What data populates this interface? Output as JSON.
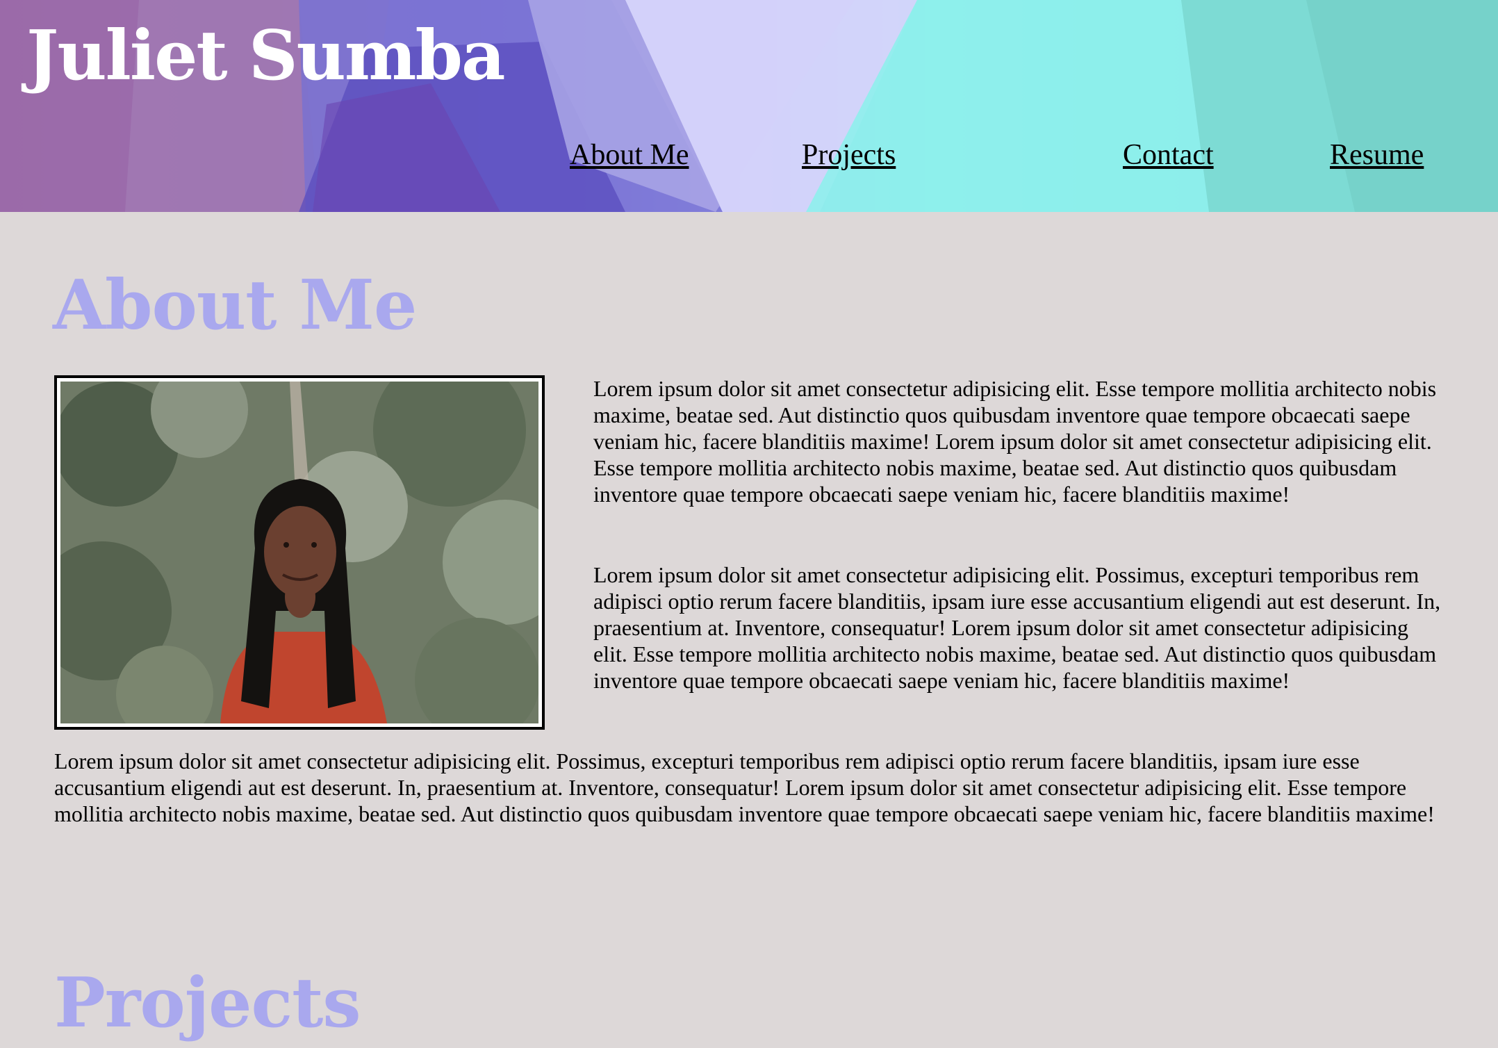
{
  "header": {
    "site_title": "Juliet Sumba",
    "nav": [
      {
        "label": "About Me"
      },
      {
        "label": "Projects"
      },
      {
        "label": "Contact"
      },
      {
        "label": "Resume"
      }
    ]
  },
  "about": {
    "heading": "About Me",
    "paragraphs": [
      "Lorem ipsum dolor sit amet consectetur adipisicing elit. Esse tempore mollitia architecto nobis maxime, beatae sed. Aut distinctio quos quibusdam inventore quae tempore obcaecati saepe veniam hic, facere blanditiis maxime! Lorem ipsum dolor sit amet consectetur adipisicing elit. Esse tempore mollitia architecto nobis maxime, beatae sed. Aut distinctio quos quibusdam inventore quae tempore obcaecati saepe veniam hic, facere blanditiis maxime!",
      "Lorem ipsum dolor sit amet consectetur adipisicing elit. Possimus, excepturi temporibus rem adipisci optio rerum facere blanditiis, ipsam iure esse accusantium eligendi aut est deserunt. In, praesentium at. Inventore, consequatur! Lorem ipsum dolor sit amet consectetur adipisicing elit. Esse tempore mollitia architecto nobis maxime, beatae sed. Aut distinctio quos quibusdam inventore quae tempore obcaecati saepe veniam hic, facere blanditiis maxime!",
      "Lorem ipsum dolor sit amet consectetur adipisicing elit. Possimus, excepturi temporibus rem adipisci optio rerum facere blanditiis, ipsam iure esse accusantium eligendi aut est deserunt. In, praesentium at. Inventore, consequatur! Lorem ipsum dolor sit amet consectetur adipisicing elit. Esse tempore mollitia architecto nobis maxime, beatae sed. Aut distinctio quos quibusdam inventore quae tempore obcaecati saepe veniam hic, facere blanditiis maxime!"
    ]
  },
  "projects": {
    "heading": "Projects"
  },
  "colors": {
    "page_background": "#ddd8d8",
    "heading_color": "#a9a8ee",
    "title_color": "#ffffff"
  }
}
